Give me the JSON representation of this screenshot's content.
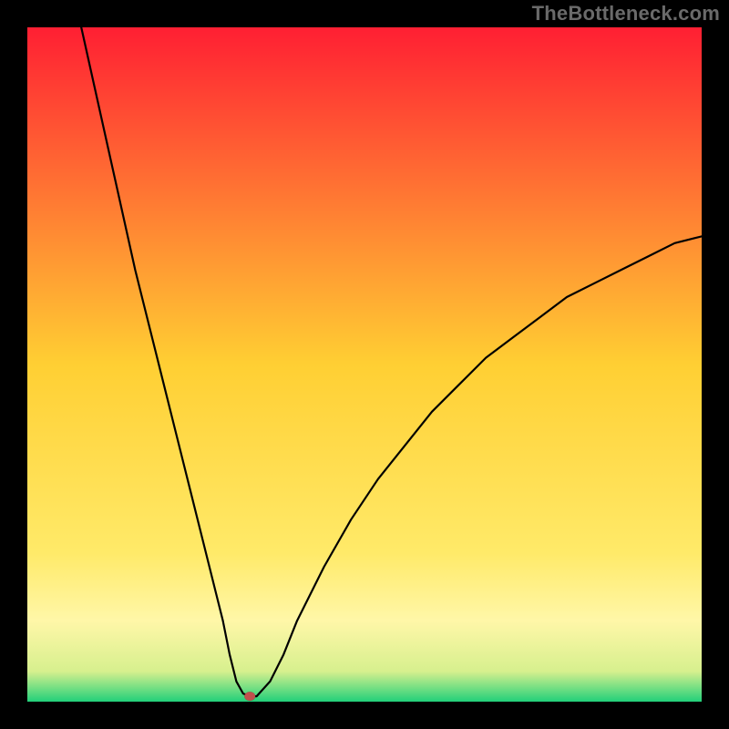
{
  "watermark": "TheBottleneck.com",
  "chart_data": {
    "type": "line",
    "title": "",
    "xlabel": "",
    "ylabel": "",
    "xlim": [
      0,
      100
    ],
    "ylim": [
      0,
      100
    ],
    "background_gradient": {
      "stops": [
        {
          "offset": 0.0,
          "color": "#ff1f33"
        },
        {
          "offset": 0.5,
          "color": "#ffcf33"
        },
        {
          "offset": 0.78,
          "color": "#ffea69"
        },
        {
          "offset": 0.88,
          "color": "#fff7a8"
        },
        {
          "offset": 0.955,
          "color": "#d7f08e"
        },
        {
          "offset": 1.0,
          "color": "#22d07a"
        }
      ]
    },
    "series": [
      {
        "name": "bottleneck-curve",
        "x": [
          8,
          10,
          12,
          14,
          16,
          18,
          20,
          22,
          24,
          26,
          28,
          29,
          30,
          31,
          32,
          33,
          34,
          36,
          38,
          40,
          44,
          48,
          52,
          56,
          60,
          64,
          68,
          72,
          76,
          80,
          84,
          88,
          92,
          96,
          100
        ],
        "y": [
          100,
          91,
          82,
          73,
          64,
          56,
          48,
          40,
          32,
          24,
          16,
          12,
          7,
          3,
          1.2,
          0.8,
          0.8,
          3,
          7,
          12,
          20,
          27,
          33,
          38,
          43,
          47,
          51,
          54,
          57,
          60,
          62,
          64,
          66,
          68,
          69
        ]
      }
    ],
    "marker": {
      "x": 33,
      "y": 0.8,
      "color": "#c0504d"
    }
  }
}
